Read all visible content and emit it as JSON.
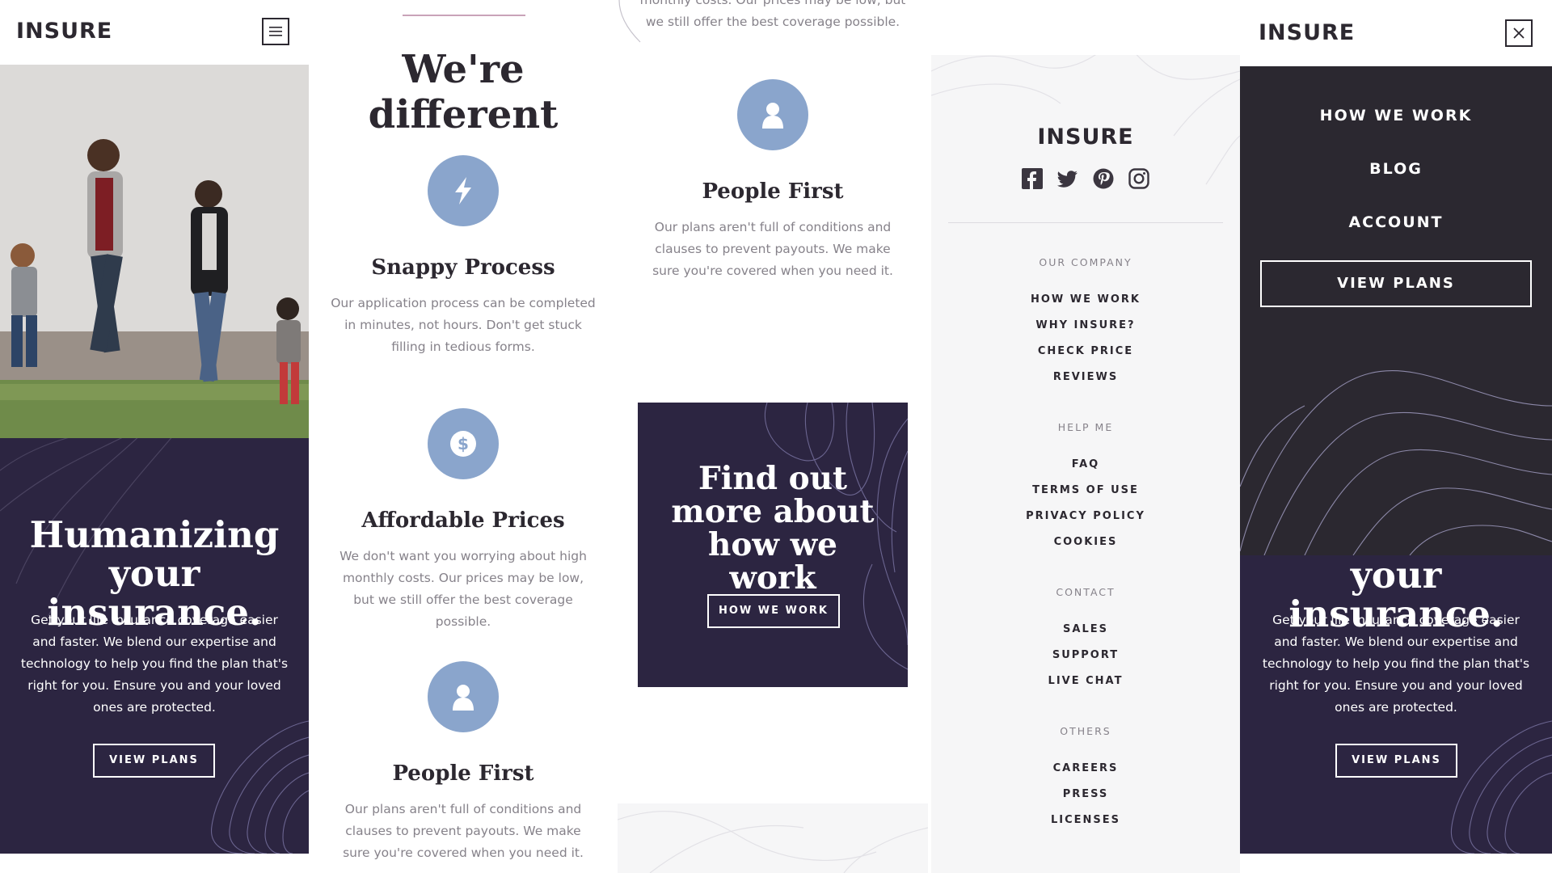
{
  "brand": {
    "logo": "INSURE"
  },
  "hero": {
    "title_line1": "Humanizing",
    "title_line2": "your insurance.",
    "text": "Get your life insurance coverage easier and faster. We blend our expertise and technology to help you find the plan that's right for you. Ensure you and your loved ones are protected.",
    "cta": "VIEW PLANS"
  },
  "features": {
    "title": "We're different",
    "items": [
      {
        "title": "Snappy Process",
        "text": "Our application process can be completed in minutes, not hours. Don't get stuck filling in tedious forms.",
        "icon": "lightning-icon"
      },
      {
        "title": "Affordable Prices",
        "text": "We don't want you worrying about high monthly costs. Our prices may be low, but we still offer the best coverage possible.",
        "icon": "dollar-icon"
      },
      {
        "title": "People First",
        "text": "Our plans aren't full of conditions and clauses to prevent payouts. We make sure you're covered when you need it.",
        "icon": "person-icon"
      }
    ],
    "partial_text_top": "monthly costs. Our prices may be low, but",
    "partial_text_line2": "we still offer the best coverage possible."
  },
  "cta_box": {
    "title": "Find out more about how we work",
    "button": "HOW WE WORK"
  },
  "footer": {
    "social": [
      "facebook-icon",
      "twitter-icon",
      "pinterest-icon",
      "instagram-icon"
    ],
    "sections": [
      {
        "heading": "OUR COMPANY",
        "links": [
          "HOW WE WORK",
          "WHY INSURE?",
          "CHECK PRICE",
          "REVIEWS"
        ]
      },
      {
        "heading": "HELP ME",
        "links": [
          "FAQ",
          "TERMS OF USE",
          "PRIVACY POLICY",
          "COOKIES"
        ]
      },
      {
        "heading": "CONTACT",
        "links": [
          "SALES",
          "SUPPORT",
          "LIVE CHAT"
        ]
      },
      {
        "heading": "OTHERS",
        "links": [
          "CAREERS",
          "PRESS",
          "LICENSES"
        ]
      }
    ]
  },
  "mobile_menu": {
    "items": [
      "HOW WE WORK",
      "BLOG",
      "ACCOUNT"
    ],
    "cta": "VIEW PLANS"
  },
  "colors": {
    "dark_violet": "#2c2541",
    "menu_dark": "#2b2830",
    "icon_blue": "#8aa5cc",
    "pink": "#c9a3b8"
  }
}
